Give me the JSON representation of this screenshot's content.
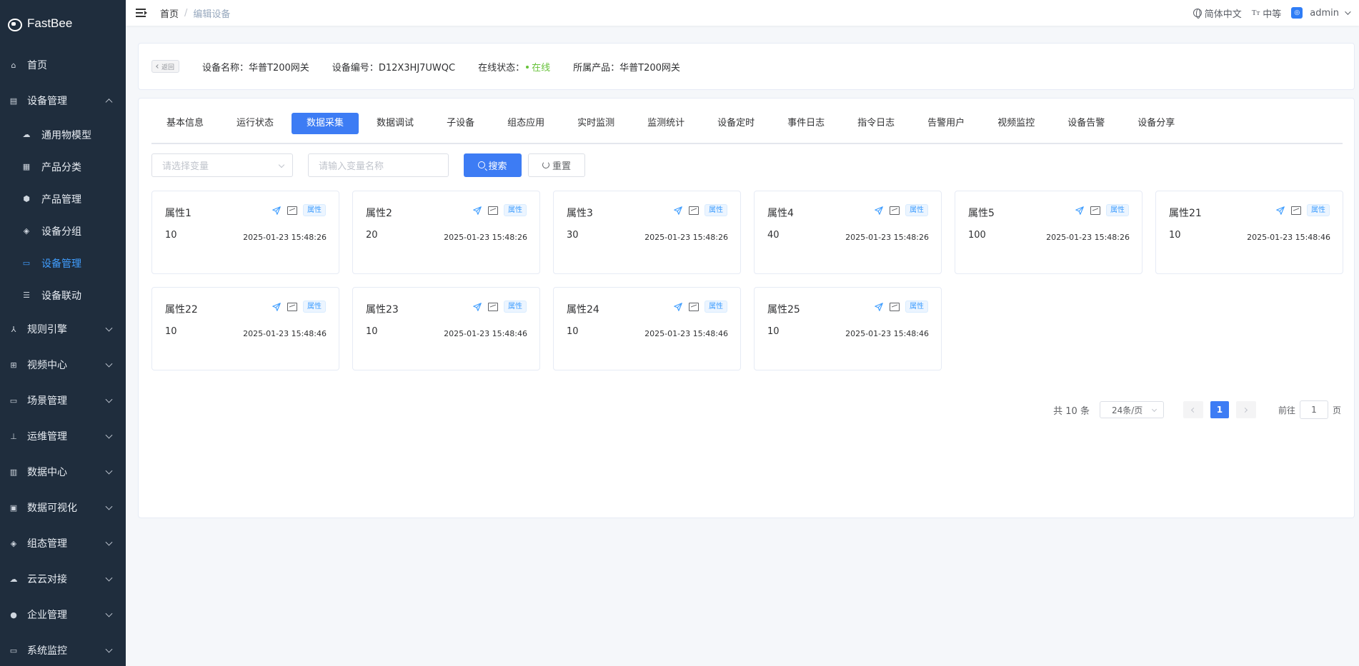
{
  "app": {
    "name": "FastBee"
  },
  "colors": {
    "sidebar_bg": "#1f2d3d",
    "primary": "#3d7cf4",
    "online": "#67c23a",
    "active_menu": "#409eff"
  },
  "sidebar": {
    "items": [
      {
        "label": "首页",
        "icon": "home-icon"
      },
      {
        "label": "设备管理",
        "icon": "device-icon",
        "expanded": true,
        "children": [
          {
            "label": "通用物模型",
            "icon": "model-icon"
          },
          {
            "label": "产品分类",
            "icon": "category-icon"
          },
          {
            "label": "产品管理",
            "icon": "product-icon"
          },
          {
            "label": "设备分组",
            "icon": "group-icon"
          },
          {
            "label": "设备管理",
            "icon": "device-manage-icon",
            "active": true
          },
          {
            "label": "设备联动",
            "icon": "linkage-icon"
          }
        ]
      },
      {
        "label": "规则引擎",
        "icon": "rule-icon"
      },
      {
        "label": "视频中心",
        "icon": "video-icon"
      },
      {
        "label": "场景管理",
        "icon": "scene-icon"
      },
      {
        "label": "运维管理",
        "icon": "ops-icon"
      },
      {
        "label": "数据中心",
        "icon": "data-icon"
      },
      {
        "label": "数据可视化",
        "icon": "visual-icon"
      },
      {
        "label": "组态管理",
        "icon": "config-icon"
      },
      {
        "label": "云云对接",
        "icon": "cloud-icon"
      },
      {
        "label": "企业管理",
        "icon": "enterprise-icon"
      },
      {
        "label": "系统监控",
        "icon": "monitor-icon"
      }
    ]
  },
  "header": {
    "breadcrumb": [
      "首页",
      "编辑设备"
    ],
    "language": "简体中文",
    "font_size": "中等",
    "user": "admin"
  },
  "device_info": {
    "back_label": "返回",
    "name_label": "设备名称：",
    "name": "华普T200网关",
    "serial_label": "设备编号：",
    "serial": "D12X3HJ7UWQC",
    "status_label": "在线状态：",
    "status": "在线",
    "product_label": "所属产品：",
    "product": "华普T200网关"
  },
  "tabs": [
    {
      "label": "基本信息"
    },
    {
      "label": "运行状态"
    },
    {
      "label": "数据采集",
      "active": true
    },
    {
      "label": "数据调试"
    },
    {
      "label": "子设备"
    },
    {
      "label": "组态应用"
    },
    {
      "label": "实时监测"
    },
    {
      "label": "监测统计"
    },
    {
      "label": "设备定时"
    },
    {
      "label": "事件日志"
    },
    {
      "label": "指令日志"
    },
    {
      "label": "告警用户"
    },
    {
      "label": "视频监控"
    },
    {
      "label": "设备告警"
    },
    {
      "label": "设备分享"
    }
  ],
  "filters": {
    "variable_select_placeholder": "请选择变量",
    "variable_name_placeholder": "请输入变量名称",
    "search_label": "搜索",
    "reset_label": "重置"
  },
  "cards": [
    {
      "name": "属性1",
      "value": "10",
      "time": "2025-01-23 15:48:26",
      "tag": "属性"
    },
    {
      "name": "属性2",
      "value": "20",
      "time": "2025-01-23 15:48:26",
      "tag": "属性"
    },
    {
      "name": "属性3",
      "value": "30",
      "time": "2025-01-23 15:48:26",
      "tag": "属性"
    },
    {
      "name": "属性4",
      "value": "40",
      "time": "2025-01-23 15:48:26",
      "tag": "属性"
    },
    {
      "name": "属性5",
      "value": "100",
      "time": "2025-01-23 15:48:26",
      "tag": "属性"
    },
    {
      "name": "属性21",
      "value": "10",
      "time": "2025-01-23 15:48:46",
      "tag": "属性"
    },
    {
      "name": "属性22",
      "value": "10",
      "time": "2025-01-23 15:48:46",
      "tag": "属性"
    },
    {
      "name": "属性23",
      "value": "10",
      "time": "2025-01-23 15:48:46",
      "tag": "属性"
    },
    {
      "name": "属性24",
      "value": "10",
      "time": "2025-01-23 15:48:46",
      "tag": "属性"
    },
    {
      "name": "属性25",
      "value": "10",
      "time": "2025-01-23 15:48:46",
      "tag": "属性"
    }
  ],
  "pagination": {
    "total": "共 10 条",
    "page_size": "24条/页",
    "current_page": "1",
    "goto_prefix": "前往",
    "goto_value": "1",
    "goto_suffix": "页"
  }
}
